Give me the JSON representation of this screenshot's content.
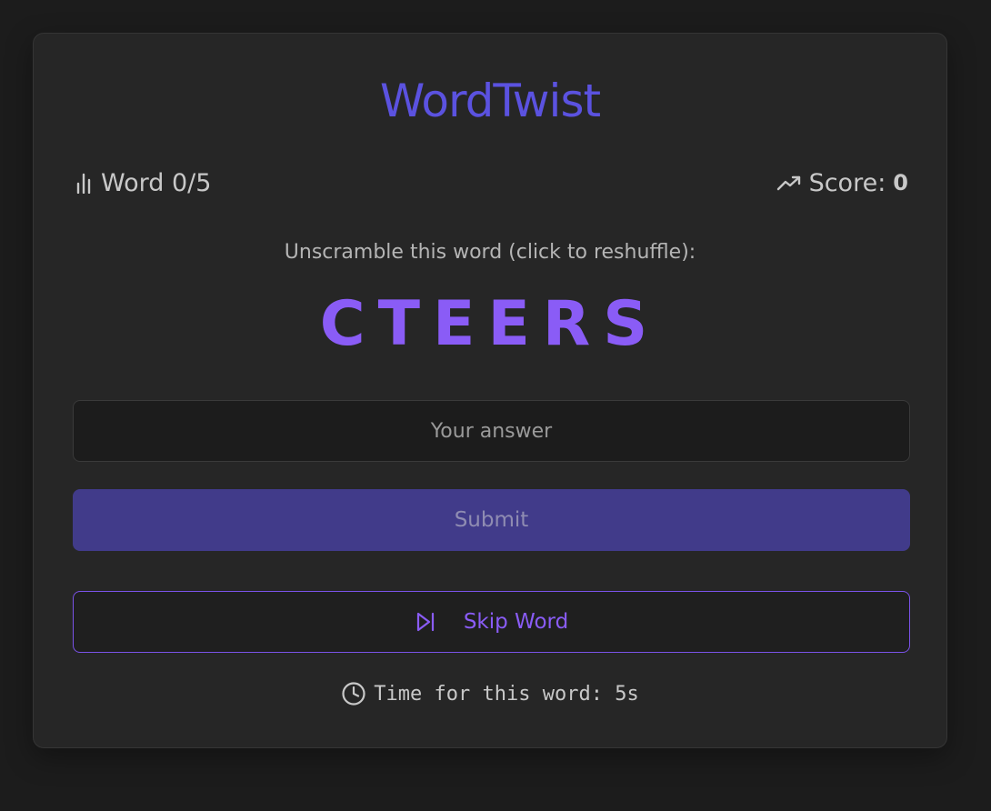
{
  "app": {
    "title": "WordTwist"
  },
  "stats": {
    "progress_label": "Word 0/5",
    "progress_icon": "bar-chart-icon",
    "score_label": "Score:",
    "score_value": "0",
    "score_icon": "trending-up-icon"
  },
  "puzzle": {
    "prompt": "Unscramble this word (click to reshuffle):",
    "scrambled": "CTEERS"
  },
  "answer": {
    "placeholder": "Your answer",
    "value": ""
  },
  "actions": {
    "submit_label": "Submit",
    "skip_label": "Skip Word",
    "skip_icon": "skip-forward-icon"
  },
  "timer": {
    "label": "Time for this word: 5s",
    "icon": "clock-icon"
  },
  "colors": {
    "accent": "#5b52e0",
    "letters": "#8a5cf6",
    "submit_bg": "#413b8a",
    "background": "#1c1c1c",
    "card": "#262626"
  }
}
